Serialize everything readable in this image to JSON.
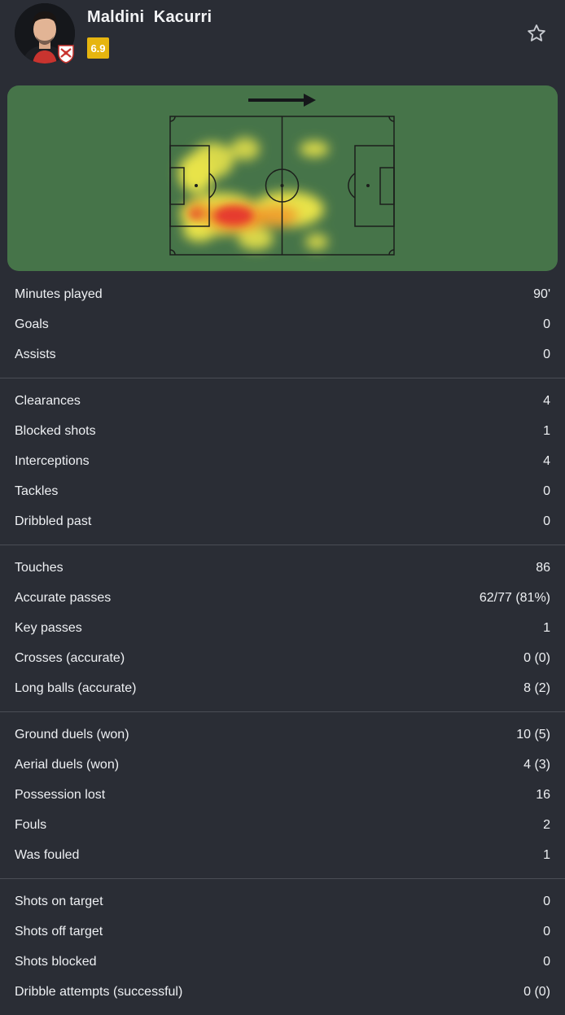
{
  "player": {
    "first_name": "Maldini",
    "last_name": "Kacurri",
    "full_name": "Maldini  Kacurri",
    "rating": "6.9",
    "rating_color": "#e6b50f",
    "avatar_icon": "player-avatar",
    "club_icon": "club-crest-icon",
    "favorite_icon": "star-outline-icon"
  },
  "heatmap": {
    "direction_icon": "arrow-right-icon",
    "pitch_color": "#467449"
  },
  "stat_groups": [
    [
      {
        "label": "Minutes played",
        "value": "90'"
      },
      {
        "label": "Goals",
        "value": "0"
      },
      {
        "label": "Assists",
        "value": "0"
      }
    ],
    [
      {
        "label": "Clearances",
        "value": "4"
      },
      {
        "label": "Blocked shots",
        "value": "1"
      },
      {
        "label": "Interceptions",
        "value": "4"
      },
      {
        "label": "Tackles",
        "value": "0"
      },
      {
        "label": "Dribbled past",
        "value": "0"
      }
    ],
    [
      {
        "label": "Touches",
        "value": "86"
      },
      {
        "label": "Accurate passes",
        "value": "62/77 (81%)"
      },
      {
        "label": "Key passes",
        "value": "1"
      },
      {
        "label": "Crosses (accurate)",
        "value": "0 (0)"
      },
      {
        "label": "Long balls (accurate)",
        "value": "8 (2)"
      }
    ],
    [
      {
        "label": "Ground duels (won)",
        "value": "10 (5)"
      },
      {
        "label": "Aerial duels (won)",
        "value": "4 (3)"
      },
      {
        "label": "Possession lost",
        "value": "16"
      },
      {
        "label": "Fouls",
        "value": "2"
      },
      {
        "label": "Was fouled",
        "value": "1"
      }
    ],
    [
      {
        "label": "Shots on target",
        "value": "0"
      },
      {
        "label": "Shots off target",
        "value": "0"
      },
      {
        "label": "Shots blocked",
        "value": "0"
      },
      {
        "label": "Dribble attempts (successful)",
        "value": "0 (0)"
      }
    ]
  ]
}
